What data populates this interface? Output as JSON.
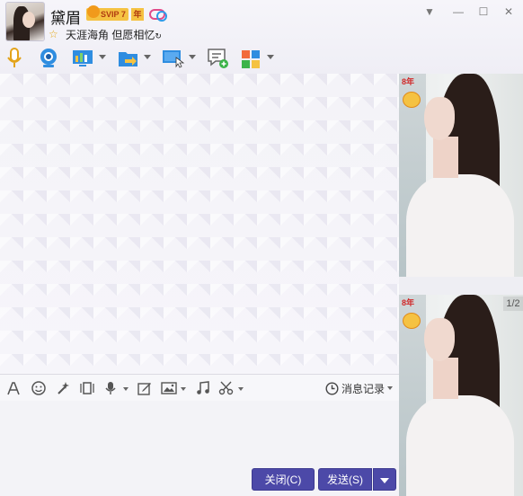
{
  "header": {
    "contact_name": "黛眉",
    "vip_badge": "SVIP 7",
    "year_badge": "年",
    "signature": "天涯海角 但愿相忆"
  },
  "window_controls": [
    "menu-icon",
    "minimize-icon",
    "maximize-icon",
    "close-icon"
  ],
  "toolbar": {
    "items": [
      "voice-call-icon",
      "video-call-icon",
      "screen-share-icon",
      "file-transfer-icon",
      "remote-assist-icon",
      "message-bubble-icon",
      "apps-grid-icon"
    ]
  },
  "format_bar": {
    "items": [
      "font-icon",
      "emoji-icon",
      "magic-wand-icon",
      "screen-shake-icon",
      "voice-message-icon",
      "handwriting-icon",
      "image-icon",
      "music-icon",
      "screenshot-scissors-icon"
    ],
    "history_label": "消息记录"
  },
  "buttons": {
    "close_label": "关闭(C)",
    "send_label": "发送(S)"
  },
  "side_panel": {
    "pager": "1/2",
    "decor_label": "8年"
  },
  "colors": {
    "button_bg": "#4c49a8",
    "vip_gold": "#f5c242",
    "header_bg": "#f6f5fa"
  }
}
